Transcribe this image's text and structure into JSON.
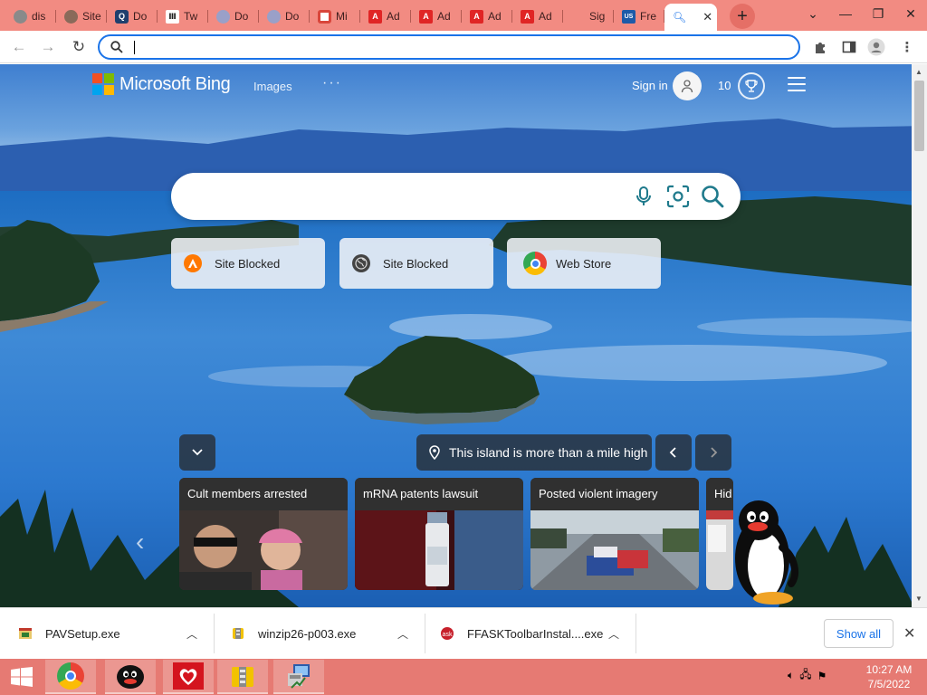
{
  "browser": {
    "tabs": [
      {
        "label": "dis",
        "icon": "globe-icon",
        "color": "#8a8a8a"
      },
      {
        "label": "Site",
        "icon": "globe-icon",
        "color": "#8a8a8a"
      },
      {
        "label": "Do",
        "icon": "q-icon",
        "color": "#1f3f6e"
      },
      {
        "label": "Tw",
        "icon": "pillar-icon",
        "color": "#222222"
      },
      {
        "label": "Do",
        "icon": "globe-icon",
        "color": "#9aa0c8"
      },
      {
        "label": "Do",
        "icon": "globe-icon",
        "color": "#9aa0c8"
      },
      {
        "label": "Mi",
        "icon": "paint-icon",
        "color": "#d9463b"
      },
      {
        "label": "Ad",
        "icon": "adobe-icon",
        "color": "#e02525"
      },
      {
        "label": "Ad",
        "icon": "adobe-icon",
        "color": "#e02525"
      },
      {
        "label": "Ad",
        "icon": "adobe-icon",
        "color": "#e02525"
      },
      {
        "label": "Ad",
        "icon": "adobe-icon",
        "color": "#e02525"
      },
      {
        "label": "Sig",
        "icon": "microsoft-icon",
        "color": "#7fba00"
      },
      {
        "label": "Fre",
        "icon": "usa-icon",
        "color": "#1e5aa8"
      }
    ],
    "active_tab_close": "✕",
    "new_tab": "+",
    "address": {
      "value": "",
      "placeholder": ""
    }
  },
  "bing": {
    "brand": "Microsoft Bing",
    "nav_images": "Images",
    "nav_more": "···",
    "signin": "Sign in",
    "points": "10",
    "search": {
      "value": "",
      "placeholder": ""
    },
    "quick_links": [
      {
        "label": "Site Blocked",
        "icon": "avast-icon",
        "color": "#ff7800"
      },
      {
        "label": "Site Blocked",
        "icon": "globe-icon",
        "color": "#444444"
      },
      {
        "label": "Web Store",
        "icon": "chrome-icon",
        "color": "#4285f4"
      }
    ],
    "caption": "This island is more than a mile high",
    "news": [
      {
        "title": "Cult members arrested"
      },
      {
        "title": "mRNA patents lawsuit"
      },
      {
        "title": "Posted violent imagery"
      },
      {
        "title": "Hid"
      }
    ]
  },
  "downloads": {
    "items": [
      {
        "name": "PAVSetup.exe"
      },
      {
        "name": "winzip26-p003.exe"
      },
      {
        "name": "FFASKToolbarInstal....exe"
      }
    ],
    "show_all": "Show all"
  },
  "taskbar": {
    "time": "10:27 AM",
    "date": "7/5/2022"
  },
  "colors": {
    "tabstrip": "#f28b82",
    "taskbar": "#e67a73",
    "accent": "#1a73e8",
    "bing_icon_teal": "#1f7a8c"
  }
}
